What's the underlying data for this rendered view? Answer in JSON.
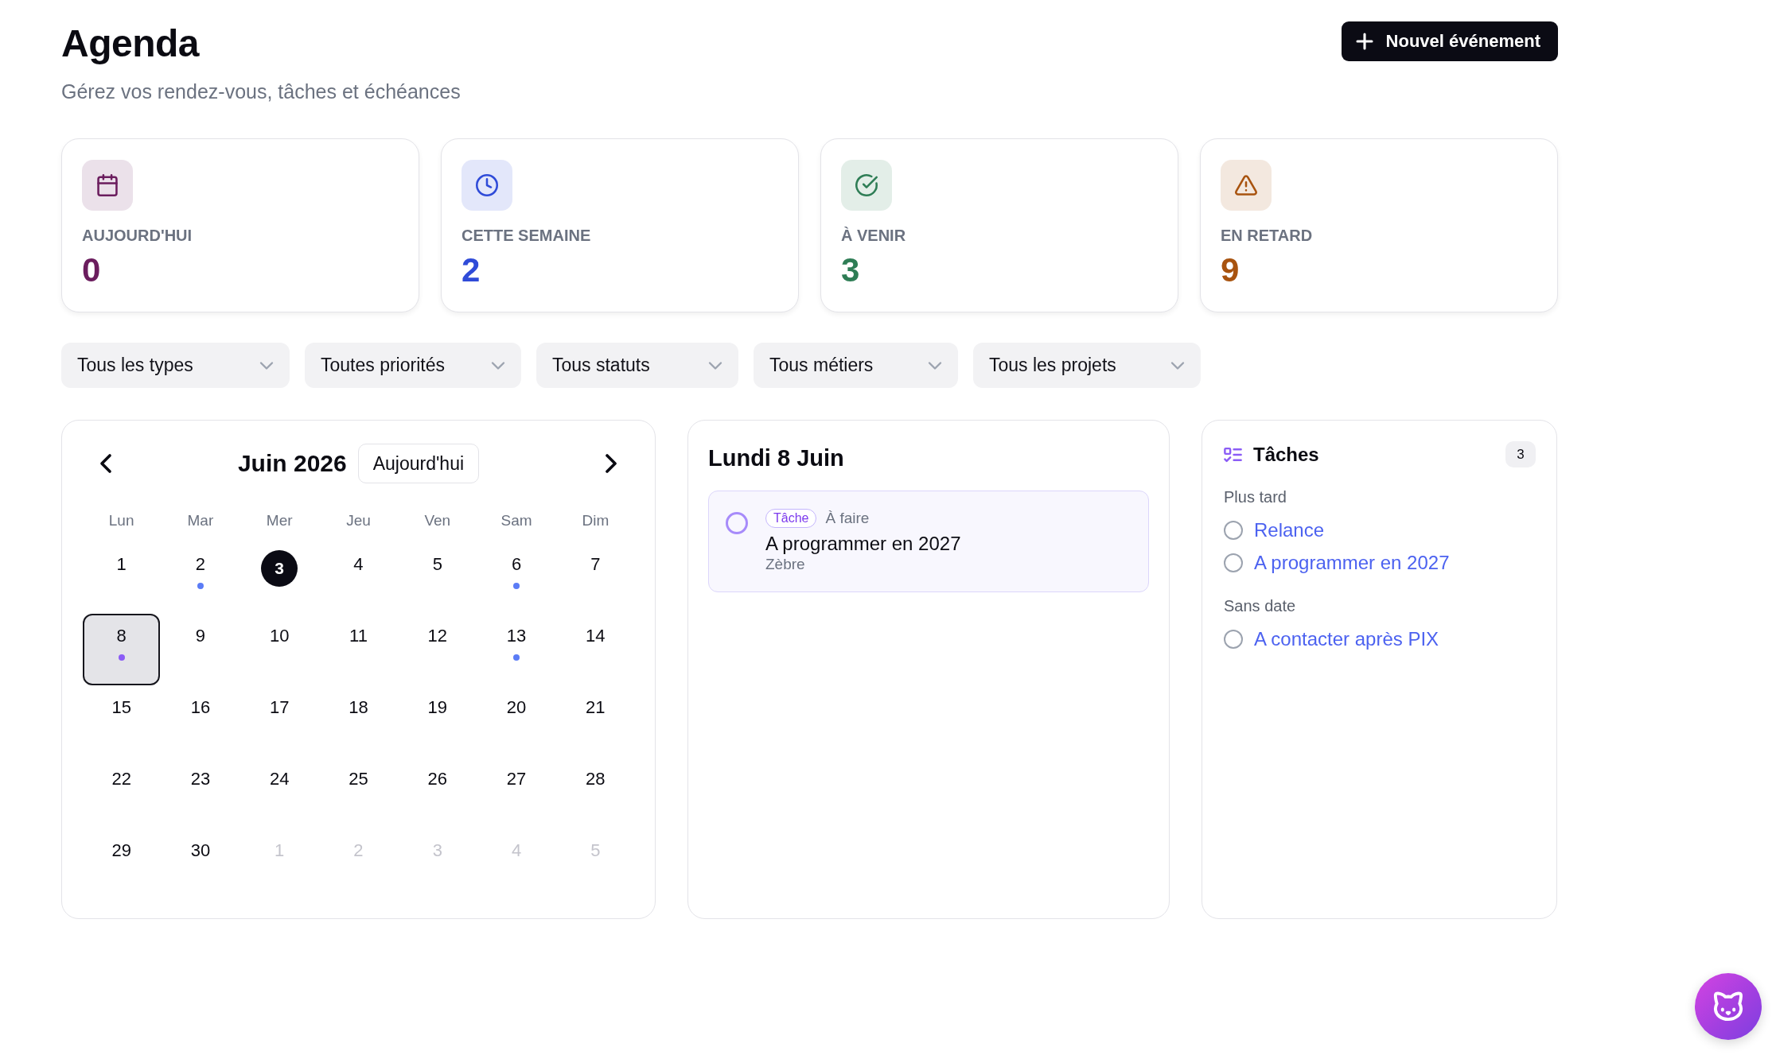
{
  "header": {
    "title": "Agenda",
    "subtitle": "Gérez vos rendez-vous, tâches et échéances",
    "action_button": "Nouvel événement"
  },
  "stats": [
    {
      "kind": "calendar",
      "label": "AUJOURD'HUI",
      "value": "0",
      "color": "#6b1d5e"
    },
    {
      "kind": "clock",
      "label": "CETTE SEMAINE",
      "value": "2",
      "color": "#2f4bd8"
    },
    {
      "kind": "check",
      "label": "À VENIR",
      "value": "3",
      "color": "#2e7d55"
    },
    {
      "kind": "warning",
      "label": "EN RETARD",
      "value": "9",
      "color": "#a8530f"
    }
  ],
  "filters": [
    "Tous les types",
    "Toutes priorités",
    "Tous statuts",
    "Tous métiers",
    "Tous les projets"
  ],
  "calendar": {
    "month": "Juin 2026",
    "today_button": "Aujourd'hui",
    "weekdays": [
      "Lun",
      "Mar",
      "Mer",
      "Jeu",
      "Ven",
      "Sam",
      "Dim"
    ],
    "days": [
      {
        "label": "1",
        "muted": false,
        "today": false,
        "selected": false
      },
      {
        "label": "2",
        "muted": false,
        "today": false,
        "selected": false,
        "color": "#5b7cf6"
      },
      {
        "label": "3",
        "muted": false,
        "today": true,
        "selected": false
      },
      {
        "label": "4",
        "muted": false,
        "today": false,
        "selected": false
      },
      {
        "label": "5",
        "muted": false,
        "today": false,
        "selected": false
      },
      {
        "label": "6",
        "muted": false,
        "today": false,
        "selected": false,
        "color": "#5b7cf6"
      },
      {
        "label": "7",
        "muted": false,
        "today": false,
        "selected": false
      },
      {
        "label": "8",
        "muted": false,
        "today": false,
        "selected": true,
        "color": "#8b5cf6"
      },
      {
        "label": "9",
        "muted": false,
        "today": false,
        "selected": false
      },
      {
        "label": "10",
        "muted": false,
        "today": false,
        "selected": false
      },
      {
        "label": "11",
        "muted": false,
        "today": false,
        "selected": false
      },
      {
        "label": "12",
        "muted": false,
        "today": false,
        "selected": false
      },
      {
        "label": "13",
        "muted": false,
        "today": false,
        "selected": false,
        "color": "#5b7cf6"
      },
      {
        "label": "14",
        "muted": false,
        "today": false,
        "selected": false
      },
      {
        "label": "15",
        "muted": false,
        "today": false,
        "selected": false
      },
      {
        "label": "16",
        "muted": false,
        "today": false,
        "selected": false
      },
      {
        "label": "17",
        "muted": false,
        "today": false,
        "selected": false
      },
      {
        "label": "18",
        "muted": false,
        "today": false,
        "selected": false
      },
      {
        "label": "19",
        "muted": false,
        "today": false,
        "selected": false
      },
      {
        "label": "20",
        "muted": false,
        "today": false,
        "selected": false
      },
      {
        "label": "21",
        "muted": false,
        "today": false,
        "selected": false
      },
      {
        "label": "22",
        "muted": false,
        "today": false,
        "selected": false
      },
      {
        "label": "23",
        "muted": false,
        "today": false,
        "selected": false
      },
      {
        "label": "24",
        "muted": false,
        "today": false,
        "selected": false
      },
      {
        "label": "25",
        "muted": false,
        "today": false,
        "selected": false
      },
      {
        "label": "26",
        "muted": false,
        "today": false,
        "selected": false
      },
      {
        "label": "27",
        "muted": false,
        "today": false,
        "selected": false
      },
      {
        "label": "28",
        "muted": false,
        "today": false,
        "selected": false
      },
      {
        "label": "29",
        "muted": false,
        "today": false,
        "selected": false
      },
      {
        "label": "30",
        "muted": false,
        "today": false,
        "selected": false
      },
      {
        "label": "1",
        "muted": true,
        "today": false,
        "selected": false
      },
      {
        "label": "2",
        "muted": true,
        "today": false,
        "selected": false
      },
      {
        "label": "3",
        "muted": true,
        "today": false,
        "selected": false
      },
      {
        "label": "4",
        "muted": true,
        "today": false,
        "selected": false
      },
      {
        "label": "5",
        "muted": true,
        "today": false,
        "selected": false
      }
    ]
  },
  "day_panel": {
    "title": "Lundi 8 Juin",
    "events": [
      {
        "tag": "Tâche",
        "status": "À faire",
        "title": "A programmer en 2027",
        "project": "Zèbre",
        "done": false
      }
    ]
  },
  "tasks": {
    "title": "Tâches",
    "count": "3",
    "groups": [
      {
        "label": "Plus tard",
        "items": [
          {
            "label": "Relance",
            "done": false
          },
          {
            "label": "A programmer en 2027",
            "done": false
          }
        ]
      },
      {
        "label": "Sans date",
        "items": [
          {
            "label": "A contacter après PIX",
            "done": false
          }
        ]
      }
    ]
  }
}
